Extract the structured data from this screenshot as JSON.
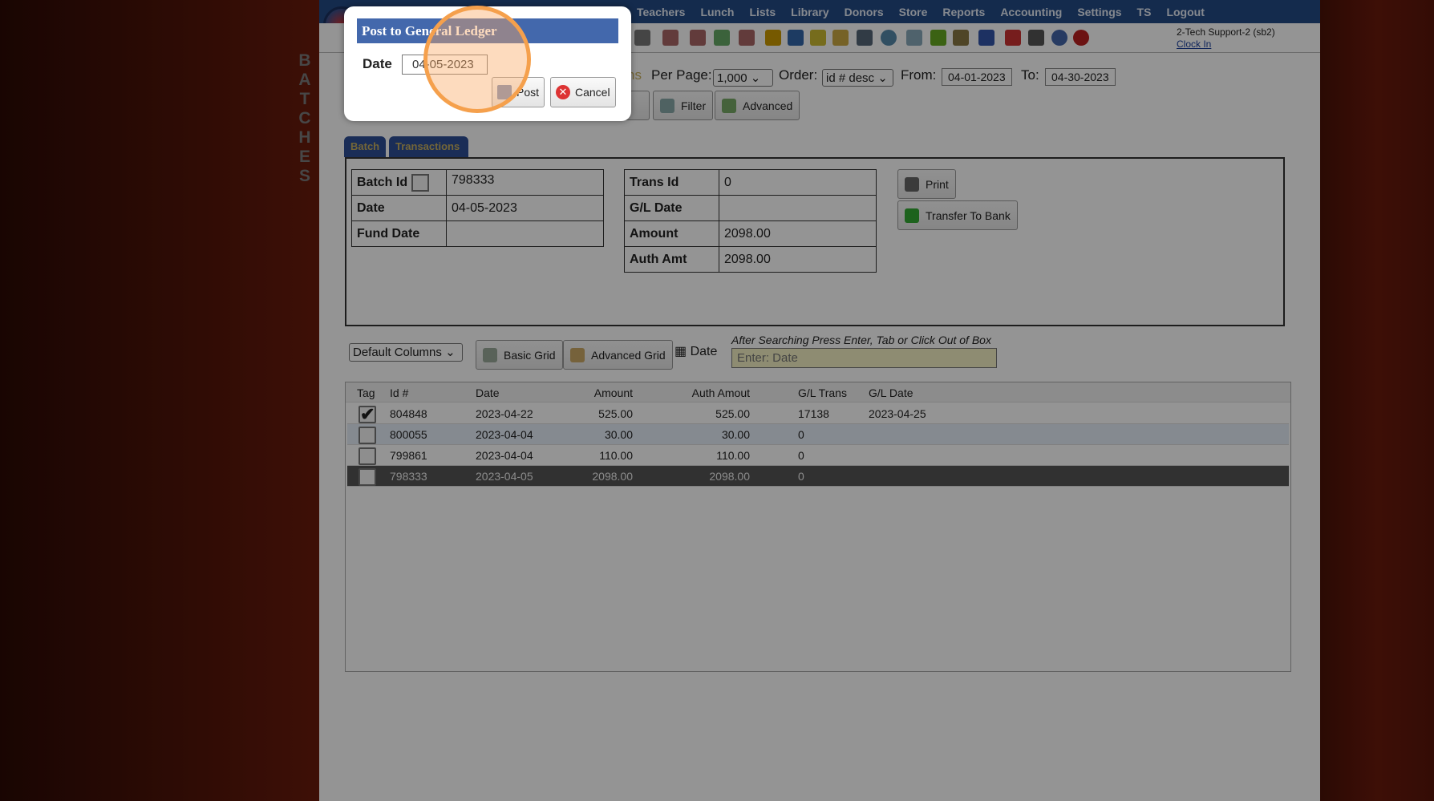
{
  "nav": {
    "items": [
      "Teachers",
      "Lunch",
      "Lists",
      "Library",
      "Donors",
      "Store",
      "Reports",
      "Accounting",
      "Settings",
      "TS",
      "Logout"
    ]
  },
  "user": {
    "name": "2-Tech Support-2 (sb2)",
    "clock_in": "Clock In"
  },
  "side_label": [
    "B",
    "A",
    "T",
    "C",
    "H",
    "E",
    "S"
  ],
  "filters": {
    "trans_fragment": "ns",
    "per_page_label": "Per Page:",
    "per_page_value": "1,000",
    "order_label": "Order:",
    "order_value": "id # desc",
    "from_label": "From:",
    "from_value": "04-01-2023",
    "to_label": "To:",
    "to_value": "04-30-2023"
  },
  "buttons": {
    "refresh_fragment": "sh",
    "filter": "Filter",
    "advanced": "Advanced",
    "print": "Print",
    "transfer": "Transfer To Bank",
    "basic_grid": "Basic Grid",
    "advanced_grid": "Advanced Grid"
  },
  "tabs": {
    "batch": "Batch",
    "transactions": "Transactions"
  },
  "batch_info": {
    "batch_id_label": "Batch Id",
    "batch_id": "798333",
    "date_label": "Date",
    "date": "04-05-2023",
    "fund_date_label": "Fund Date",
    "fund_date": ""
  },
  "trans_info": {
    "trans_id_label": "Trans Id",
    "trans_id": "0",
    "gl_date_label": "G/L Date",
    "gl_date": "",
    "amount_label": "Amount",
    "amount": "2098.00",
    "auth_amt_label": "Auth Amt",
    "auth_amt": "2098.00"
  },
  "grid_controls": {
    "columns_select": "Default Columns",
    "date_label": "Date",
    "hint": "After Searching Press Enter, Tab or Click Out of Box",
    "search_placeholder": "Enter: Date"
  },
  "grid": {
    "columns": [
      "Tag",
      "Id #",
      "Date",
      "Amount",
      "Auth Amout",
      "G/L Trans",
      "G/L Date"
    ],
    "rows": [
      {
        "id": "804848",
        "date": "2023-04-22",
        "amount": "525.00",
        "auth": "525.00",
        "gl_trans": "17138",
        "gl_date": "2023-04-25",
        "tagged": true
      },
      {
        "id": "800055",
        "date": "2023-04-04",
        "amount": "30.00",
        "auth": "30.00",
        "gl_trans": "0",
        "gl_date": "",
        "tagged": false
      },
      {
        "id": "799861",
        "date": "2023-04-04",
        "amount": "110.00",
        "auth": "110.00",
        "gl_trans": "0",
        "gl_date": "",
        "tagged": false
      },
      {
        "id": "798333",
        "date": "2023-04-05",
        "amount": "2098.00",
        "auth": "2098.00",
        "gl_trans": "0",
        "gl_date": "",
        "tagged": false
      }
    ]
  },
  "dialog": {
    "title": "Post to General Ledger",
    "date_label": "Date",
    "date_value": "04-05-2023",
    "post": "Post",
    "cancel": "Cancel"
  }
}
